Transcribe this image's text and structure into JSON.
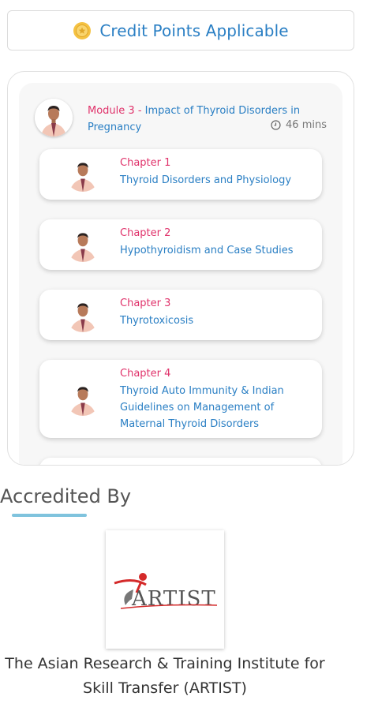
{
  "credit": {
    "label": "Credit Points Applicable",
    "icon": "coin-icon",
    "icon_color": "#f5c242",
    "text_color": "#2a7fc4"
  },
  "module": {
    "number": "Module 3",
    "separator": " - ",
    "title": "Impact of Thyroid Disorders in Pregnancy",
    "duration": "46 mins",
    "duration_icon": "clock-icon"
  },
  "chapters": [
    {
      "label": "Chapter 1",
      "title": "Thyroid Disorders and Physiology"
    },
    {
      "label": "Chapter 2",
      "title": "Hypothyroidism and Case Studies"
    },
    {
      "label": "Chapter 3",
      "title": "Thyrotoxicosis"
    },
    {
      "label": "Chapter 4",
      "title": "Thyroid Auto Immunity & Indian Guidelines on Management of Maternal Thyroid Disorders"
    }
  ],
  "accredited": {
    "heading": "Accredited By",
    "logo_text": "ARTIST",
    "organization": "The Asian Research & Training Institute for Skill Transfer (ARTIST)"
  },
  "colors": {
    "accent_blue": "#2a7fc4",
    "accent_pink": "#e0336b",
    "underline": "#7fc3dd"
  }
}
